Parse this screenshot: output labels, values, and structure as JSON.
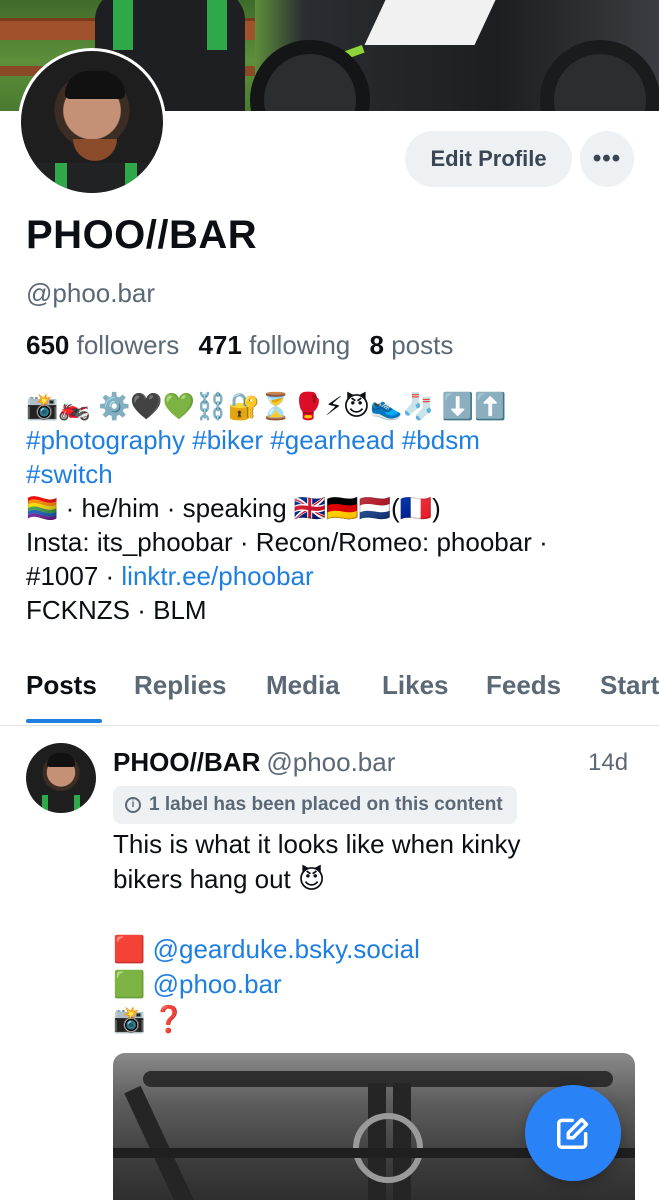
{
  "profile": {
    "edit_label": "Edit Profile",
    "more_label": "•••",
    "display_name": "PHOO//BAR",
    "handle": "@phoo.bar",
    "stats": {
      "followers_count": "650",
      "followers_label": "followers",
      "following_count": "471",
      "following_label": "following",
      "posts_count": "8",
      "posts_label": "posts"
    },
    "bio": {
      "emoji_line": "📸🏍️ ⚙️🖤💚⛓️🔐⏳🥊⚡😈👟🧦 ⬇️⬆️",
      "hashtags_line1": "#photography #biker #gearhead #bdsm",
      "hashtags_line2": "#switch",
      "pride_line": "🏳️‍🌈 · he/him · speaking 🇬🇧🇩🇪🇳🇱(🇫🇷)",
      "insta_line": "Insta: its_phoobar · Recon/Romeo: phoobar ·",
      "link_prefix": "#1007 · ",
      "link_text": "linktr.ee/phoobar",
      "last_line": "FCKNZS · BLM"
    }
  },
  "tabs": [
    {
      "label": "Posts"
    },
    {
      "label": "Replies"
    },
    {
      "label": "Media"
    },
    {
      "label": "Likes"
    },
    {
      "label": "Feeds"
    },
    {
      "label": "Starter Packs"
    }
  ],
  "post": {
    "author": "PHOO//BAR",
    "handle": "@phoo.bar",
    "time": "14d",
    "label_text": "1 label has been placed on this content",
    "text_line1": "This is what it looks like when kinky",
    "text_line2": "bikers hang out 😈",
    "mention1_prefix": "🟥 ",
    "mention1": "@gearduke.bsky.social",
    "mention2_prefix": "🟩 ",
    "mention2": "@phoo.bar",
    "credit_line": "📸 ❓"
  },
  "colors": {
    "accent": "#1f7fe0",
    "fab": "#2a83f6",
    "muted_text": "#5b6875",
    "pill_bg": "#eef1f4"
  },
  "icons": {
    "more": "ellipsis-icon",
    "info": "info-icon",
    "compose": "compose-icon"
  }
}
